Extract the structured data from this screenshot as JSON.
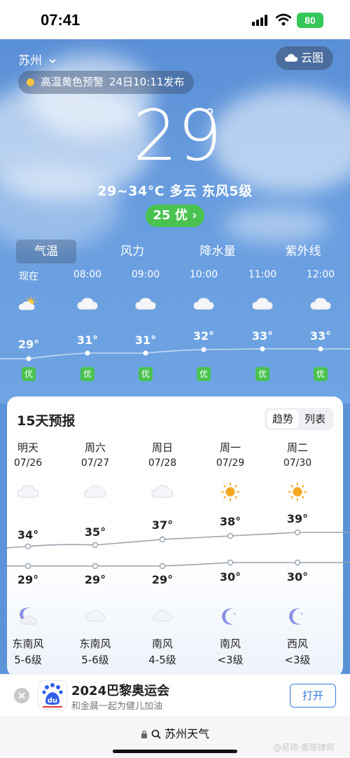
{
  "status": {
    "time": "07:41",
    "battery": "80"
  },
  "header": {
    "city": "苏州",
    "cloud_map": "云图",
    "alert_title": "高温黄色预警",
    "alert_time": "24日10:11发布"
  },
  "current": {
    "temp": "29",
    "degree": "°",
    "summary": "29~34°C 多云 东风5级",
    "aqi": "25 优 ›"
  },
  "tabs": [
    "气温",
    "风力",
    "降水量",
    "紫外线"
  ],
  "hourly": [
    {
      "time": "现在",
      "icon": "partly-sunny-icon",
      "temp": "29°",
      "aqi": "优"
    },
    {
      "time": "08:00",
      "icon": "cloud-icon",
      "temp": "31°",
      "aqi": "优"
    },
    {
      "time": "09:00",
      "icon": "cloud-icon",
      "temp": "31°",
      "aqi": "优"
    },
    {
      "time": "10:00",
      "icon": "cloud-icon",
      "temp": "32°",
      "aqi": "优"
    },
    {
      "time": "11:00",
      "icon": "cloud-icon",
      "temp": "33°",
      "aqi": "优"
    },
    {
      "time": "12:00",
      "icon": "cloud-icon",
      "temp": "33°",
      "aqi": "优"
    }
  ],
  "forecast": {
    "title": "15天预报",
    "toggle": [
      "趋势",
      "列表"
    ],
    "days": [
      {
        "name": "明天",
        "date": "07/26",
        "day_icon": "cloud-icon",
        "high": "34°",
        "low": "29°",
        "night_icon": "moon-cloud-icon",
        "wind": "东南风",
        "level": "5-6级"
      },
      {
        "name": "周六",
        "date": "07/27",
        "day_icon": "cloud-icon",
        "high": "35°",
        "low": "29°",
        "night_icon": "cloud-icon",
        "wind": "东南风",
        "level": "5-6级"
      },
      {
        "name": "周日",
        "date": "07/28",
        "day_icon": "cloud-icon",
        "high": "37°",
        "low": "29°",
        "night_icon": "cloud-icon",
        "wind": "南风",
        "level": "4-5级"
      },
      {
        "name": "周一",
        "date": "07/29",
        "day_icon": "sun-icon",
        "high": "38°",
        "low": "30°",
        "night_icon": "moon-icon",
        "wind": "南风",
        "level": "<3级"
      },
      {
        "name": "周二",
        "date": "07/30",
        "day_icon": "sun-icon",
        "high": "39°",
        "low": "30°",
        "night_icon": "moon-icon",
        "wind": "西风",
        "level": "<3级"
      }
    ]
  },
  "ad": {
    "title": "2024巴黎奥运会",
    "subtitle": "和金晨一起为健儿加油",
    "logo_text": "du",
    "button": "打开"
  },
  "browser": {
    "url": "苏州天气"
  },
  "watermark": "@易跨·重陈律师",
  "colors": {
    "sky": "#5b93d8",
    "good_aqi": "#49c24f",
    "alert": "#f5c542",
    "sun": "#f5a623",
    "moon": "#8a8fe6",
    "link": "#3c7be0"
  }
}
